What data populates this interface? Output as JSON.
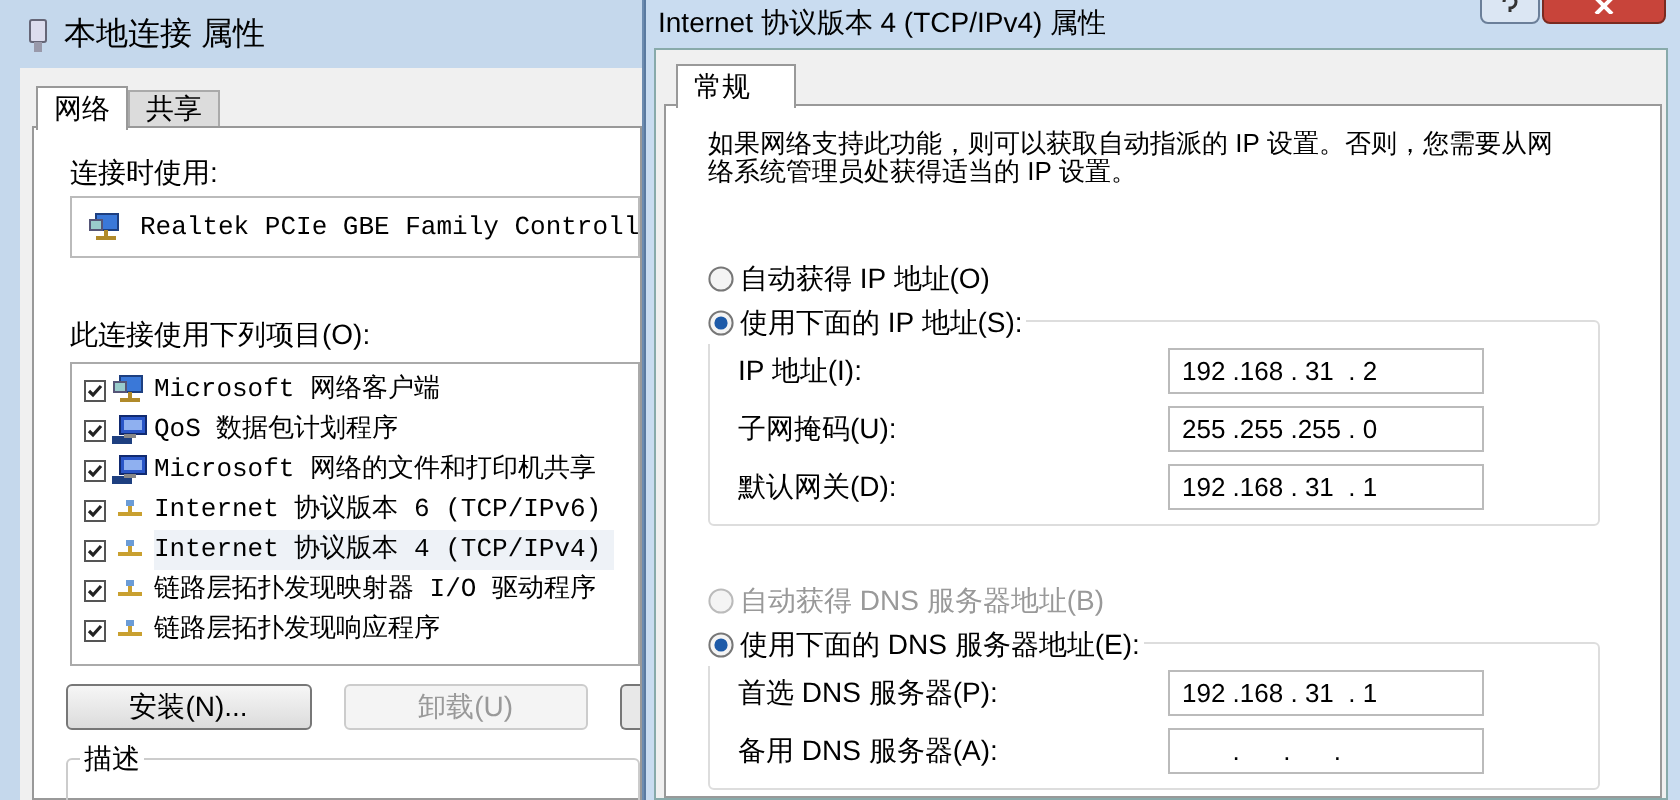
{
  "left_window": {
    "title": "本地连接 属性",
    "tabs": [
      {
        "label": "网络",
        "selected": true
      },
      {
        "label": "共享",
        "selected": false
      }
    ],
    "connect_using_label": "连接时使用:",
    "adapter": "Realtek PCIe GBE Family Controll",
    "items_label": "此连接使用下列项目(O):",
    "items": [
      {
        "kind": "client",
        "label": "Microsoft 网络客户端",
        "checked": true,
        "selected": false
      },
      {
        "kind": "service",
        "label": "QoS 数据包计划程序",
        "checked": true,
        "selected": false
      },
      {
        "kind": "service",
        "label": "Microsoft 网络的文件和打印机共享",
        "checked": true,
        "selected": false
      },
      {
        "kind": "protocol",
        "label": "Internet 协议版本 6 (TCP/IPv6)",
        "checked": true,
        "selected": false
      },
      {
        "kind": "protocol",
        "label": "Internet 协议版本 4 (TCP/IPv4)",
        "checked": true,
        "selected": true
      },
      {
        "kind": "protocol",
        "label": "链路层拓扑发现映射器 I/O 驱动程序",
        "checked": true,
        "selected": false
      },
      {
        "kind": "protocol",
        "label": "链路层拓扑发现响应程序",
        "checked": true,
        "selected": false
      }
    ],
    "buttons": [
      {
        "label": "安装(N)...",
        "disabled": false
      },
      {
        "label": "卸载(U)",
        "disabled": true
      }
    ],
    "description_label": "描述"
  },
  "right_window": {
    "title": "Internet 协议版本 4 (TCP/IPv4) 属性",
    "tabs": [
      {
        "label": "常规",
        "selected": true
      }
    ],
    "intro": "如果网络支持此功能，则可以获取自动指派的 IP 设置。否则，您需要从网络系统管理员处获得适当的 IP 设置。",
    "sections": [
      {
        "options": [
          {
            "label": "自动获得 IP 地址(O)",
            "selected": false,
            "disabled": false
          },
          {
            "label": "使用下面的 IP 地址(S):",
            "selected": true,
            "disabled": false
          }
        ],
        "fields": [
          {
            "label": "IP 地址(I):",
            "value": "192 .168 . 31  . 2"
          },
          {
            "label": "子网掩码(U):",
            "value": "255 .255 .255 . 0"
          },
          {
            "label": "默认网关(D):",
            "value": "192 .168 . 31  . 1"
          }
        ]
      },
      {
        "options": [
          {
            "label": "自动获得 DNS 服务器地址(B)",
            "selected": false,
            "disabled": true
          },
          {
            "label": "使用下面的 DNS 服务器地址(E):",
            "selected": true,
            "disabled": false
          }
        ],
        "fields": [
          {
            "label": "首选 DNS 服务器(P):",
            "value": "192 .168 . 31  . 1"
          },
          {
            "label": "备用 DNS 服务器(A):",
            "value": "       .      .      ."
          }
        ]
      }
    ]
  }
}
